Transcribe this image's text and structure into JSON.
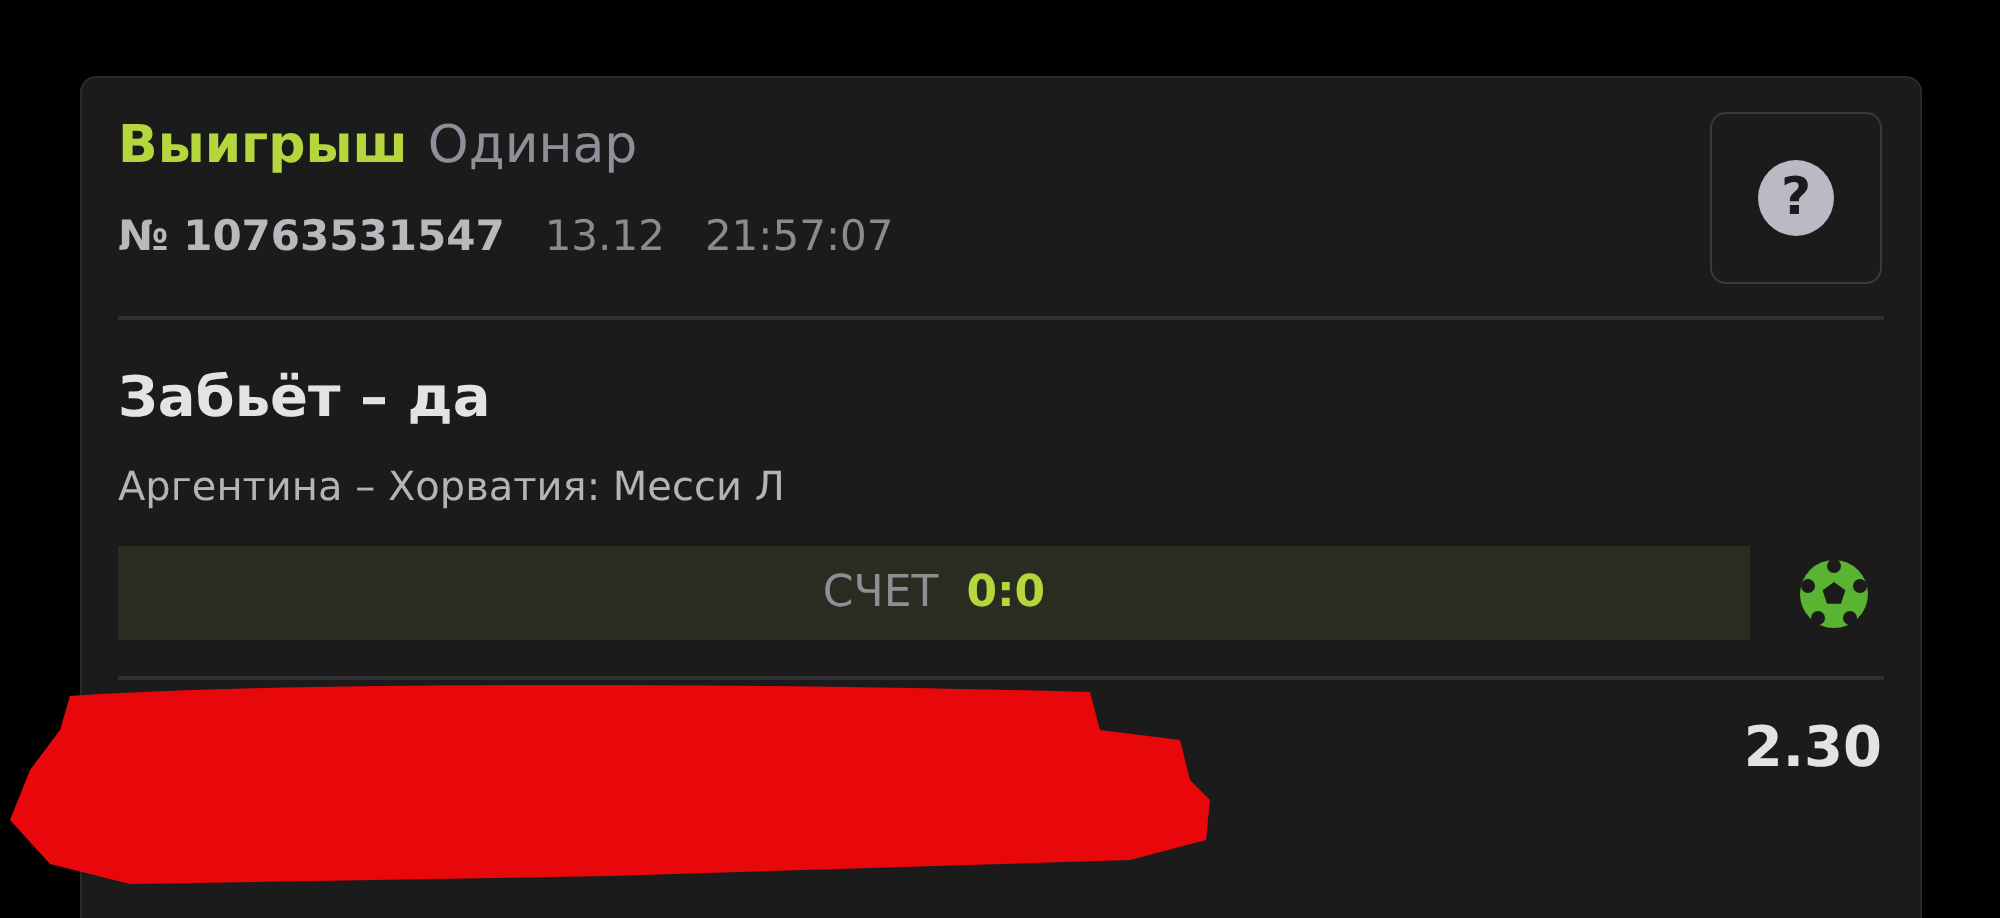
{
  "bet": {
    "status": "Выигрыш",
    "type": "Одинар",
    "number": "№ 10763531547",
    "date": "13.12",
    "time": "21:57:07",
    "help_button": "?",
    "selection": "Забьёт – да",
    "event": "Аргентина – Хорватия: Месси Л",
    "score": {
      "label": "СЧЕТ",
      "value": "0:0"
    },
    "odds": "2.30"
  }
}
